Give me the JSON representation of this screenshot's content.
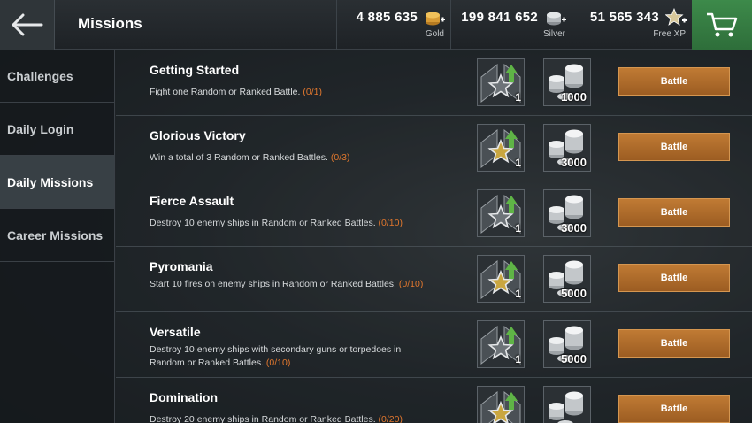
{
  "header": {
    "title": "Missions",
    "gold": {
      "amount": "4 885 635",
      "label": "Gold"
    },
    "silver": {
      "amount": "199 841 652",
      "label": "Silver"
    },
    "freexp": {
      "amount": "51 565 343",
      "label": "Free XP"
    }
  },
  "sidebar": {
    "items": [
      {
        "label": "Challenges"
      },
      {
        "label": "Daily Login"
      },
      {
        "label": "Daily Missions"
      },
      {
        "label": "Career Missions"
      }
    ],
    "active_index": 2
  },
  "missions": [
    {
      "title": "Getting Started",
      "desc": "Fight one Random or Ranked Battle.",
      "progress": "(0/1)",
      "reward1_qty": "1",
      "reward1_icon": "grey-star-chevron-icon",
      "reward2_qty": "1000",
      "button": "Battle"
    },
    {
      "title": "Glorious Victory",
      "desc": "Win a total of 3 Random or Ranked Battles.",
      "progress": "(0/3)",
      "reward1_qty": "1",
      "reward1_icon": "gold-star-chevron-icon",
      "reward2_qty": "3000",
      "button": "Battle"
    },
    {
      "title": "Fierce Assault",
      "desc": "Destroy 10 enemy ships in Random or Ranked Battles.",
      "progress": "(0/10)",
      "reward1_qty": "1",
      "reward1_icon": "grey-star-chevron-icon",
      "reward2_qty": "3000",
      "button": "Battle"
    },
    {
      "title": "Pyromania",
      "desc": "Start 10 fires on enemy ships in Random or Ranked Battles.",
      "progress": "(0/10)",
      "reward1_qty": "1",
      "reward1_icon": "gold-star-chevron-icon",
      "reward2_qty": "5000",
      "button": "Battle"
    },
    {
      "title": "Versatile",
      "desc": "Destroy 10 enemy ships with secondary guns or torpedoes in Random or Ranked Battles.",
      "progress": "(0/10)",
      "reward1_qty": "1",
      "reward1_icon": "silver-coins-chevron-icon",
      "reward2_qty": "5000",
      "button": "Battle"
    },
    {
      "title": "Domination",
      "desc": "Destroy 20 enemy ships in Random or Ranked Battles.",
      "progress": "(0/20)",
      "reward1_qty": "",
      "reward1_icon": "gold-star-chevron-icon",
      "reward2_qty": "",
      "button": "Battle"
    }
  ],
  "colors": {
    "accent": "#e0772e",
    "battle": "#b06d2c",
    "cart": "#35794a"
  }
}
